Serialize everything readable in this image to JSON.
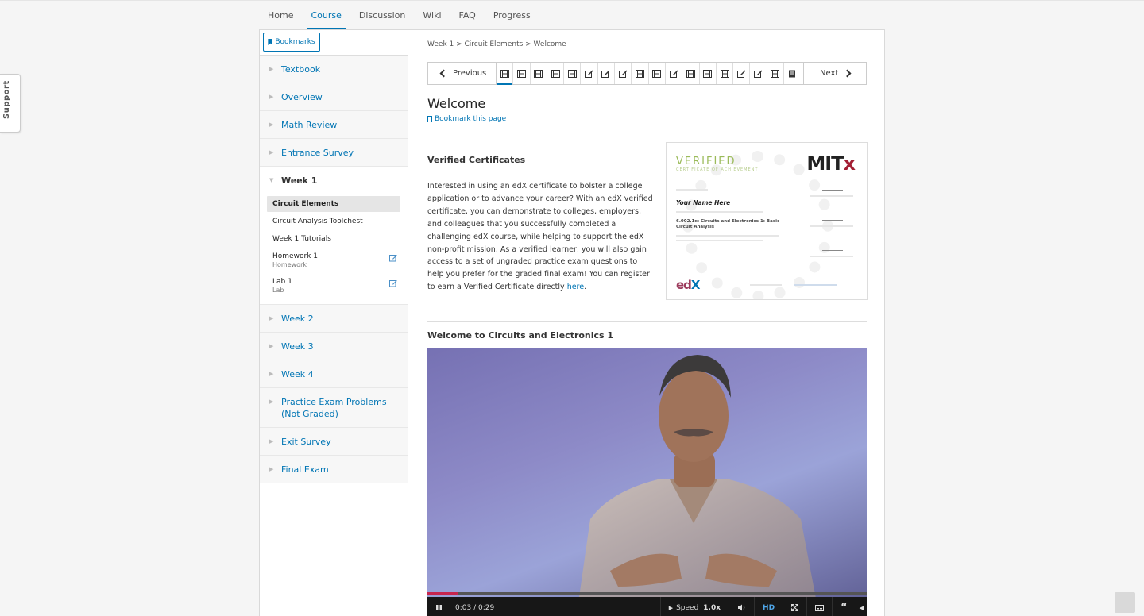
{
  "tabs": [
    "Home",
    "Course",
    "Discussion",
    "Wiki",
    "FAQ",
    "Progress"
  ],
  "support_label": "Support",
  "sidebar": {
    "bookmarks_label": "Bookmarks",
    "sections": [
      {
        "label": "Textbook"
      },
      {
        "label": "Overview"
      },
      {
        "label": "Math Review"
      },
      {
        "label": "Entrance Survey"
      },
      {
        "label": "Week 1"
      },
      {
        "label": "Week 2"
      },
      {
        "label": "Week 3"
      },
      {
        "label": "Week 4"
      },
      {
        "label": "Practice Exam Problems (Not Graded)"
      },
      {
        "label": "Exit Survey"
      },
      {
        "label": "Final Exam"
      }
    ],
    "week1_items": [
      {
        "label": "Circuit Elements",
        "meta": ""
      },
      {
        "label": "Circuit Analysis Toolchest",
        "meta": ""
      },
      {
        "label": "Week 1 Tutorials",
        "meta": ""
      },
      {
        "label": "Homework 1",
        "meta": "Homework"
      },
      {
        "label": "Lab 1",
        "meta": "Lab"
      }
    ]
  },
  "breadcrumb": "Week 1 > Circuit Elements > Welcome",
  "seq_nav": {
    "previous_label": "Previous",
    "next_label": "Next",
    "units": [
      "video-icon",
      "video-icon",
      "video-icon",
      "video-icon",
      "video-icon",
      "edit-icon",
      "edit-icon",
      "edit-icon",
      "video-icon",
      "video-icon",
      "edit-icon",
      "video-icon",
      "video-icon",
      "video-icon",
      "edit-icon",
      "edit-icon",
      "video-icon",
      "book-icon"
    ]
  },
  "page_title": "Welcome",
  "bookmark_page_label": "Bookmark this page",
  "verified": {
    "heading": "Verified Certificates",
    "text": "Interested in using an edX certificate to bolster a college application or to advance your career? With an edX verified certificate, you can demonstrate to colleges, employers, and colleagues that you successfully completed a challenging edX course, while helping to support the edX non-profit mission. As a verified learner, you will also gain access to a set of ungraded practice exam questions to help you prefer for the graded final exam! You can register to earn a Verified Certificate directly ",
    "link_text": "here",
    "link_suffix": "."
  },
  "certificate": {
    "verified_word": "VERIFIED",
    "verified_sub": "CERTIFICATE OF ACHIEVEMENT",
    "logo_main": "MIT",
    "logo_accent": "x",
    "name": "Your Name Here",
    "course": "6.002.1x: Circuits and Electronics 1: Basic Circuit Analysis",
    "edx_main": "ed",
    "edx_accent": "X"
  },
  "video": {
    "heading": "Welcome to Circuits and Electronics 1",
    "time": "0:03 / 0:29",
    "speed_label": "Speed",
    "speed_value": "1.0x",
    "hd_label": "HD",
    "progress_fraction": 0.07
  }
}
